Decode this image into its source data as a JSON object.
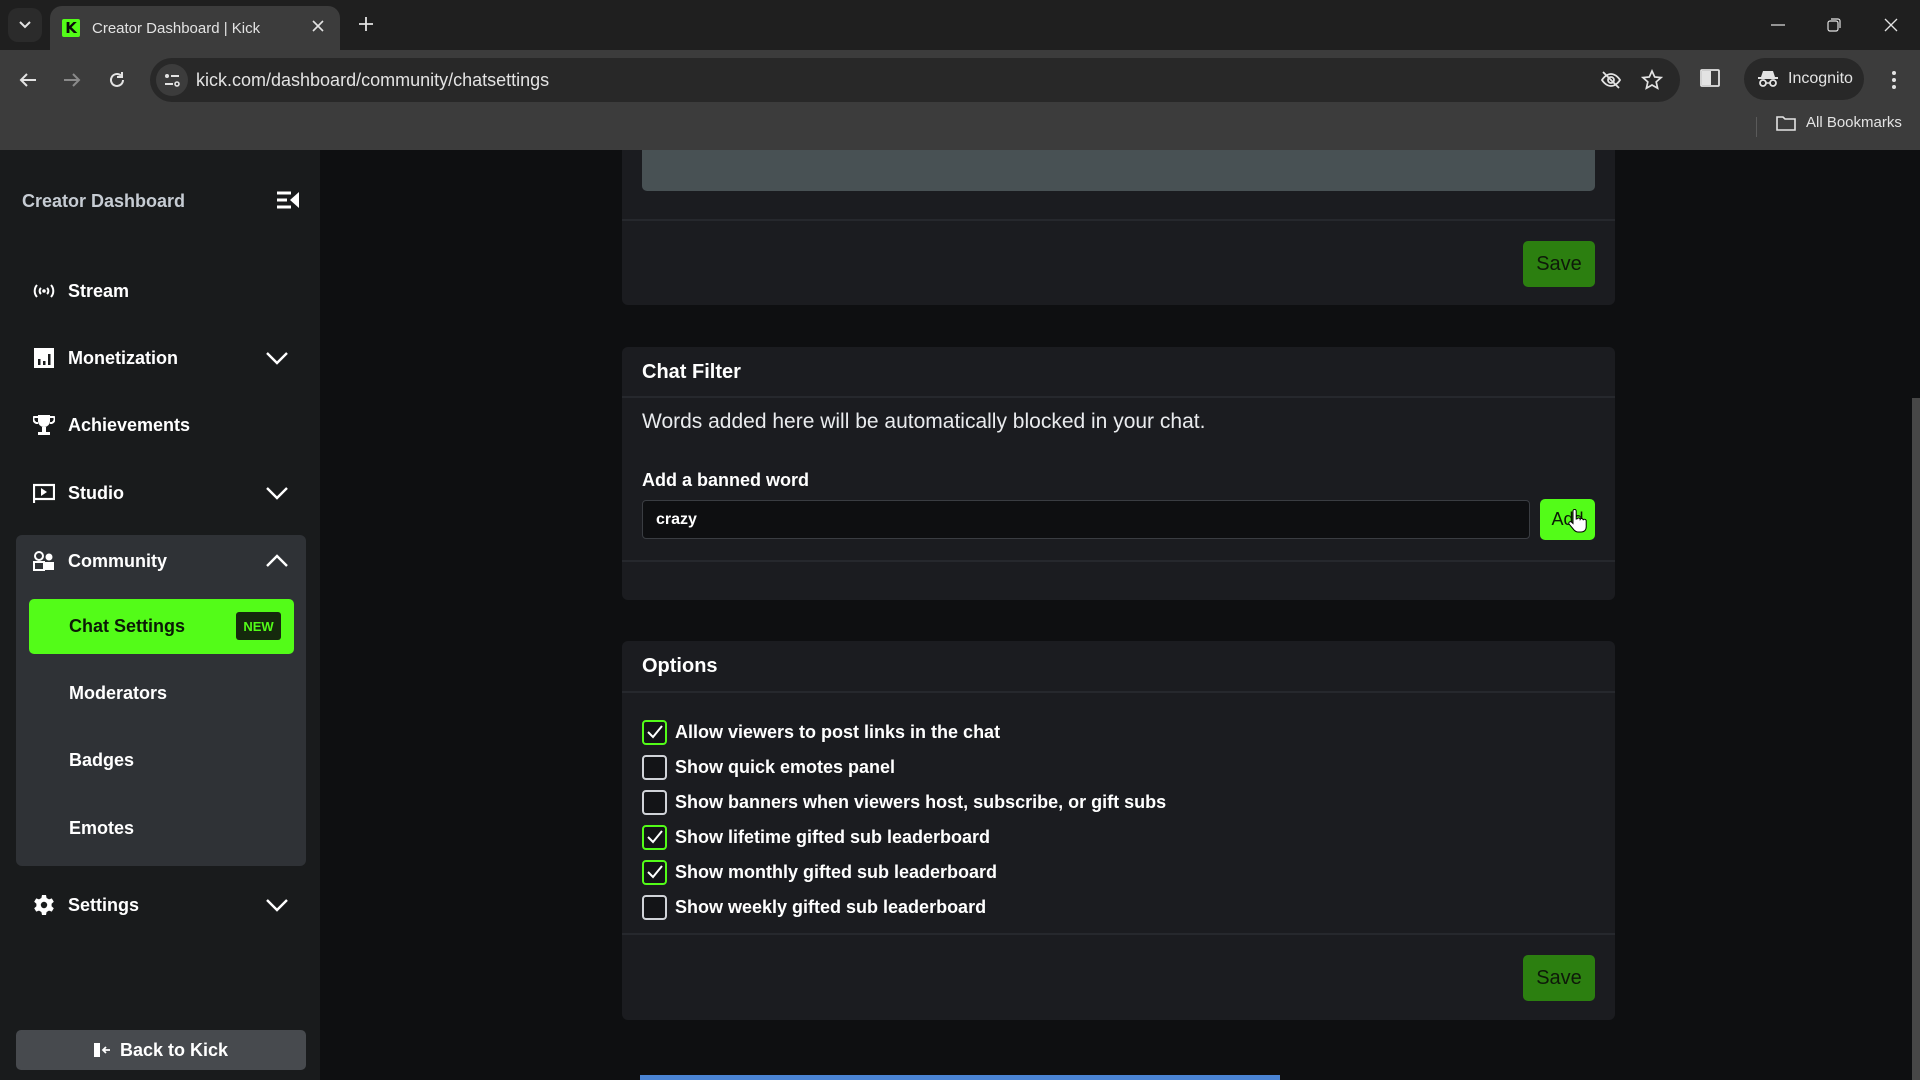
{
  "browser": {
    "tab_title": "Creator Dashboard | Kick",
    "favicon_letter": "K",
    "url": "kick.com/dashboard/community/chatsettings",
    "profile_label": "Incognito",
    "bookmarks_label": "All Bookmarks",
    "icons": {
      "tab_search": "chevron-down-icon",
      "close_tab": "close-icon",
      "new_tab": "plus-icon",
      "back": "arrow-left-icon",
      "forward": "arrow-right-icon",
      "reload": "reload-icon",
      "site_info": "tune-icon",
      "tracking": "eye-off-icon",
      "bookmark": "star-icon",
      "side_panel": "side-panel-icon",
      "menu": "kebab-menu-icon",
      "folder": "folder-icon"
    },
    "window_controls": {
      "minimize": "—",
      "restore": "❐",
      "close": "✕"
    }
  },
  "sidebar": {
    "title": "Creator Dashboard",
    "items": [
      {
        "label": "Stream",
        "icon": "broadcast-icon",
        "expandable": false
      },
      {
        "label": "Monetization",
        "icon": "bar-chart-icon",
        "expandable": true,
        "expanded": false
      },
      {
        "label": "Achievements",
        "icon": "trophy-icon",
        "expandable": false
      },
      {
        "label": "Studio",
        "icon": "video-play-icon",
        "expandable": true,
        "expanded": false
      },
      {
        "label": "Community",
        "icon": "community-icon",
        "expandable": true,
        "expanded": true
      },
      {
        "label": "Settings",
        "icon": "gear-icon",
        "expandable": true,
        "expanded": false
      }
    ],
    "community_subitems": [
      {
        "label": "Chat Settings",
        "active": true,
        "badge": "NEW"
      },
      {
        "label": "Moderators",
        "active": false
      },
      {
        "label": "Badges",
        "active": false
      },
      {
        "label": "Emotes",
        "active": false
      }
    ],
    "back_button": "Back to Kick"
  },
  "main": {
    "top_card": {
      "save_label": "Save"
    },
    "chat_filter": {
      "title": "Chat Filter",
      "description": "Words added here will be automatically blocked in your chat.",
      "field_label": "Add a banned word",
      "input_value": "crazy",
      "add_label": "Add"
    },
    "options": {
      "title": "Options",
      "items": [
        {
          "label": "Allow viewers to post links in the chat",
          "checked": true
        },
        {
          "label": "Show quick emotes panel",
          "checked": false
        },
        {
          "label": "Show banners when viewers host, subscribe, or gift subs",
          "checked": false
        },
        {
          "label": "Show lifetime gifted sub leaderboard",
          "checked": true
        },
        {
          "label": "Show monthly gifted sub leaderboard",
          "checked": true
        },
        {
          "label": "Show weekly gifted sub leaderboard",
          "checked": false
        }
      ],
      "save_label": "Save"
    }
  },
  "colors": {
    "brand_green": "#53fc18",
    "save_green": "#2c7f10",
    "sidebar_bg": "#191b1c",
    "card_bg": "#1b1c20",
    "page_bg": "#0e0f11",
    "progress_blue": "#4a84d4"
  }
}
